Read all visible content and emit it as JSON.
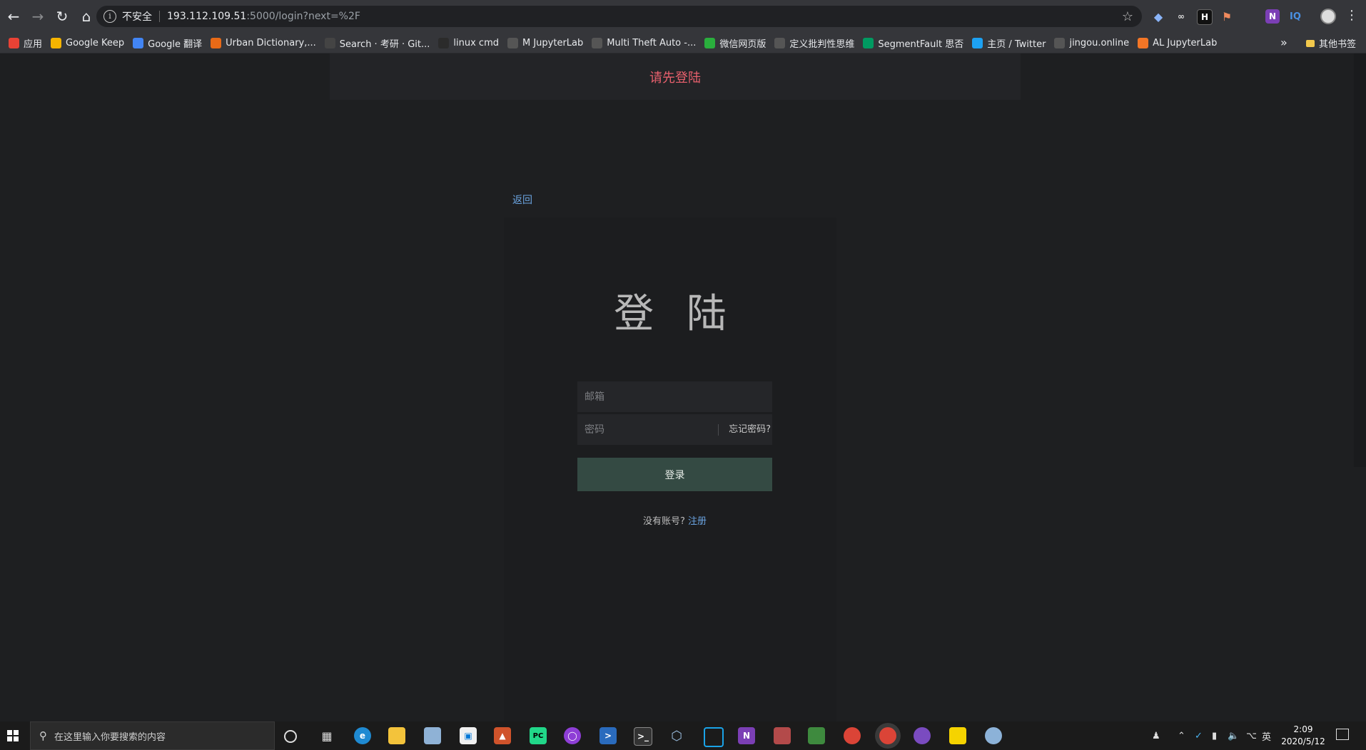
{
  "browser": {
    "insecure_label": "不安全",
    "url_host": "193.112.109.51",
    "url_path": ":5000/login?next=%2F",
    "bookmarks": [
      {
        "label": "应用",
        "icon": "apps-grid-icon",
        "color": "#e94235"
      },
      {
        "label": "Google Keep",
        "icon": "google-keep-icon",
        "color": "#f6b400"
      },
      {
        "label": "Google 翻译",
        "icon": "google-translate-icon",
        "color": "#4285f4"
      },
      {
        "label": "Urban Dictionary,...",
        "icon": "urban-dictionary-icon",
        "color": "#e86a17"
      },
      {
        "label": "Search · 考研 · Git...",
        "icon": "github-icon",
        "color": "#444444"
      },
      {
        "label": "linux cmd",
        "icon": "linux-cmd-icon",
        "color": "#2b2b2b"
      },
      {
        "label": "M JupyterLab",
        "icon": "globe-icon",
        "color": "#555555"
      },
      {
        "label": "Multi Theft Auto -...",
        "icon": "globe-icon",
        "color": "#555555"
      },
      {
        "label": "微信网页版",
        "icon": "wechat-icon",
        "color": "#2aae3d"
      },
      {
        "label": "定义批判性思维",
        "icon": "globe-icon",
        "color": "#555555"
      },
      {
        "label": "SegmentFault 思否",
        "icon": "segmentfault-icon",
        "color": "#009a61"
      },
      {
        "label": "主页 / Twitter",
        "icon": "twitter-icon",
        "color": "#1da1f2"
      },
      {
        "label": "jingou.online",
        "icon": "globe-icon",
        "color": "#555555"
      },
      {
        "label": "AL JupyterLab",
        "icon": "jupyter-icon",
        "color": "#f37626"
      }
    ],
    "other_bookmarks": "其他书签",
    "more_chevron": "»"
  },
  "flash": {
    "message": "请先登陆"
  },
  "login": {
    "back_label": "返回",
    "title": "登 陆",
    "email_placeholder": "邮箱",
    "password_placeholder": "密码",
    "forgot_label": "忘记密码?",
    "submit_label": "登录",
    "no_account_text": "没有账号?",
    "register_label": "注册"
  },
  "taskbar": {
    "search_placeholder": "在这里输入你要搜索的内容",
    "time": "2:09",
    "date": "2020/5/12",
    "ime_label": "英"
  },
  "colors": {
    "flash_text": "#e8606d",
    "link": "#6aa3e0",
    "login_button": "#344a43"
  }
}
